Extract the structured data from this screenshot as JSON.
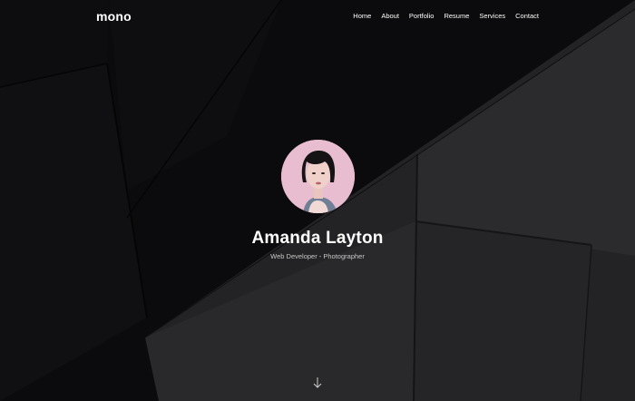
{
  "brand": {
    "logo_text": "mono"
  },
  "nav": {
    "items": [
      {
        "label": "Home"
      },
      {
        "label": "About"
      },
      {
        "label": "Portfolio"
      },
      {
        "label": "Resume"
      },
      {
        "label": "Services"
      },
      {
        "label": "Contact"
      }
    ]
  },
  "hero": {
    "name": "Amanda Layton",
    "subtitle": "Web Developer - Photographer",
    "avatar_background": "#e9bdd0"
  },
  "scroll_indicator": {
    "icon": "arrow-down-icon"
  },
  "colors": {
    "background": "#0b0b0d",
    "shape_light": "#262628",
    "text": "#ffffff",
    "subtext": "#c7c7c7"
  }
}
